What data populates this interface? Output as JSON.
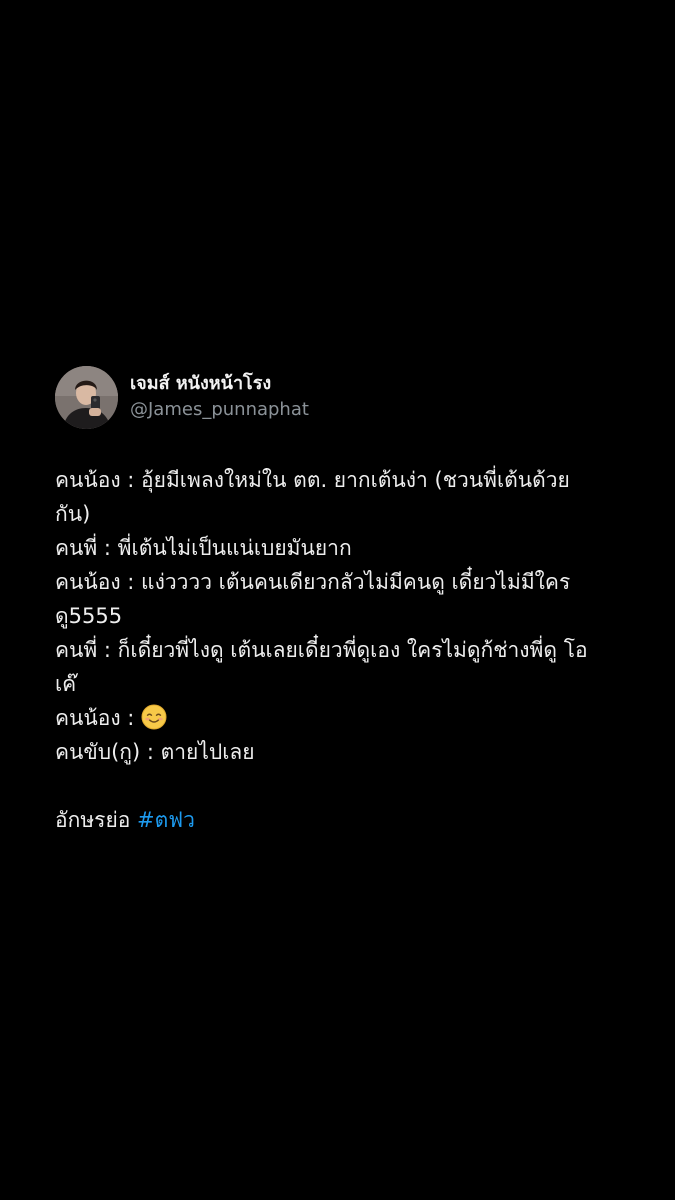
{
  "tweet": {
    "display_name": "เจมส์ หนังหน้าโรง",
    "handle": "@James_punnaphat",
    "lines": [
      "คนน้อง : อุ้ยมีเพลงใหม่ใน ตต. ยากเต้นง่า (ชวนพี่เต้นด้วย",
      "กัน)",
      "คนพี่ : พี่เต้นไม่เป็นแน่เบยมันยาก",
      "คนน้อง : แง่วววว เต้นคนเดียวกลัวไม่มีคนดู เดี๋ยวไม่มีใคร",
      "ดู5555",
      "คนพี่ : ก็เดี๋ยวพี่ไงดู เต้นเลยเดี๋ยวพี่ดูเอง ใครไม่ดูก้ช่างพี่ดู โอ",
      "เค๊",
      "คนน้อง : ",
      "คนขับ(กู) : ตายไปเลย"
    ],
    "footer_text": "อักษรย่อ ",
    "hashtag": "#ตฟว",
    "emoji": "smiling-face-icon"
  },
  "colors": {
    "background": "#000000",
    "text": "#eeeeee",
    "handle": "#8b9298",
    "hashtag": "#1d9bf0"
  }
}
